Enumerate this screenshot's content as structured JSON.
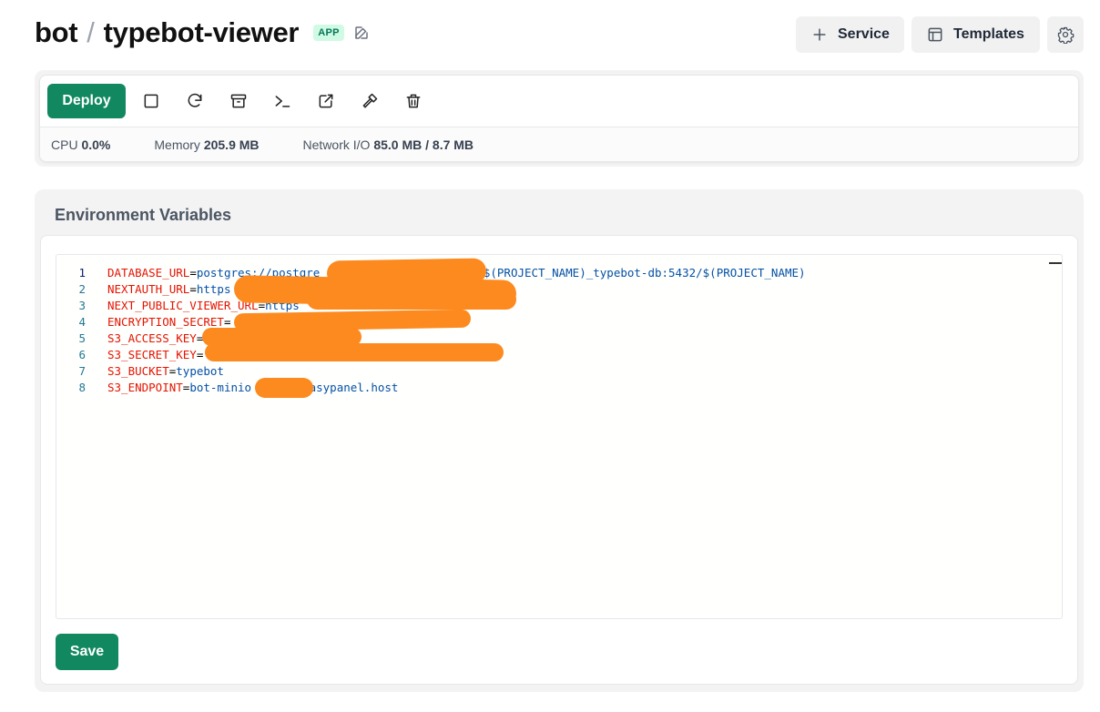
{
  "header": {
    "project": "bot",
    "separator": "/",
    "service": "typebot-viewer",
    "badge": "APP",
    "buttons": {
      "service": "Service",
      "templates": "Templates"
    }
  },
  "toolbar": {
    "deploy": "Deploy",
    "tools": [
      "stop-icon",
      "restart-icon",
      "archive-icon",
      "terminal-icon",
      "external-link-icon",
      "hammer-icon",
      "trash-icon"
    ]
  },
  "stats": {
    "cpu_label": "CPU",
    "cpu_value": "0.0%",
    "memory_label": "Memory",
    "memory_value": "205.9 MB",
    "network_label": "Network I/O",
    "network_value": "85.0 MB / 8.7 MB"
  },
  "env": {
    "title": "Environment Variables",
    "save": "Save",
    "lines": [
      {
        "num": "1",
        "key": "DATABASE_URL",
        "value": "postgres://postgre",
        "tail": "@$(PROJECT_NAME)_typebot-db:5432/$(PROJECT_NAME)"
      },
      {
        "num": "2",
        "key": "NEXTAUTH_URL",
        "value": "https",
        "tail": ""
      },
      {
        "num": "3",
        "key": "NEXT_PUBLIC_VIEWER_URL",
        "value": "https",
        "tail": ""
      },
      {
        "num": "4",
        "key": "ENCRYPTION_SECRET",
        "value": "",
        "tail": ""
      },
      {
        "num": "5",
        "key": "S3_ACCESS_KEY",
        "value": "",
        "tail": ""
      },
      {
        "num": "6",
        "key": "S3_SECRET_KEY",
        "value": "",
        "tail": ""
      },
      {
        "num": "7",
        "key": "S3_BUCKET",
        "value": "typebot",
        "tail": ""
      },
      {
        "num": "8",
        "key": "S3_ENDPOINT",
        "value": "bot-minio",
        "tail": "easypanel.host"
      }
    ]
  },
  "colors": {
    "primary": "#11885f",
    "redaction": "#fd8a1f",
    "env_key": "#e51400",
    "env_value": "#0451a5"
  }
}
